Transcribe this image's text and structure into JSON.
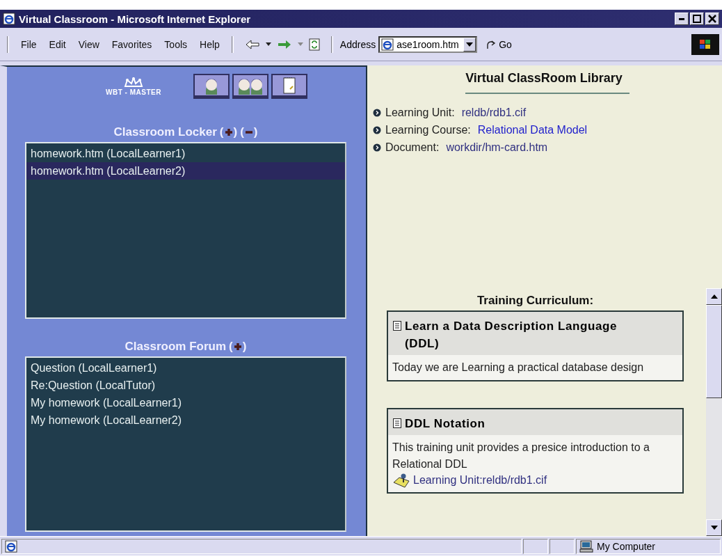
{
  "window": {
    "title": "Virtual Classroom - Microsoft Internet Explorer"
  },
  "menu": [
    "File",
    "Edit",
    "View",
    "Favorites",
    "Tools",
    "Help"
  ],
  "address": {
    "label": "Address",
    "value": "ase1room.htm",
    "go": "Go"
  },
  "sidebar": {
    "logo": "WBT - MASTER",
    "tools": [
      {
        "kind": "person"
      },
      {
        "kind": "people"
      },
      {
        "kind": "notepad"
      }
    ],
    "panels": [
      {
        "title": "Classroom Locker",
        "actions": [
          {
            "kind": "add",
            "open": "(",
            "close": ")"
          },
          {
            "kind": "remove",
            "open": "(",
            "close": ")"
          }
        ],
        "items": [
          {
            "label": "homework.htm (LocalLearner1)",
            "selected": false
          },
          {
            "label": "homework.htm (LocalLearner2)",
            "selected": true
          }
        ]
      },
      {
        "title": "Classroom Forum",
        "actions": [
          {
            "kind": "add",
            "open": "(",
            "close": ")"
          }
        ],
        "items": [
          {
            "label": "Question (LocalLearner1)",
            "selected": false
          },
          {
            "label": "Re:Question (LocalTutor)",
            "selected": false
          },
          {
            "label": "My homework (LocalLearner1)",
            "selected": false
          },
          {
            "label": "My homework (LocalLearner2)",
            "selected": false
          }
        ]
      }
    ]
  },
  "library": {
    "title": "Virtual ClassRoom Library",
    "info": [
      {
        "label": "Learning Unit:",
        "value": "reldb/rdb1.cif",
        "kind": "visited"
      },
      {
        "label": "Learning Course:",
        "value": "Relational Data Model",
        "kind": "link"
      },
      {
        "label": "Document:",
        "value": "workdir/hm-card.htm",
        "kind": "visited"
      }
    ],
    "curriculum_title": "Training Curriculum:",
    "units": [
      {
        "title": "Learn a Data Description Language (DDL)",
        "description": "Today we are Learning a practical database design"
      },
      {
        "title": "DDL Notation",
        "description": "This training unit provides a presice introduction to a Relational DDL",
        "link": "Learning Unit:reldb/rdb1.cif"
      }
    ]
  },
  "status_bar": {
    "zone": "My Computer"
  }
}
